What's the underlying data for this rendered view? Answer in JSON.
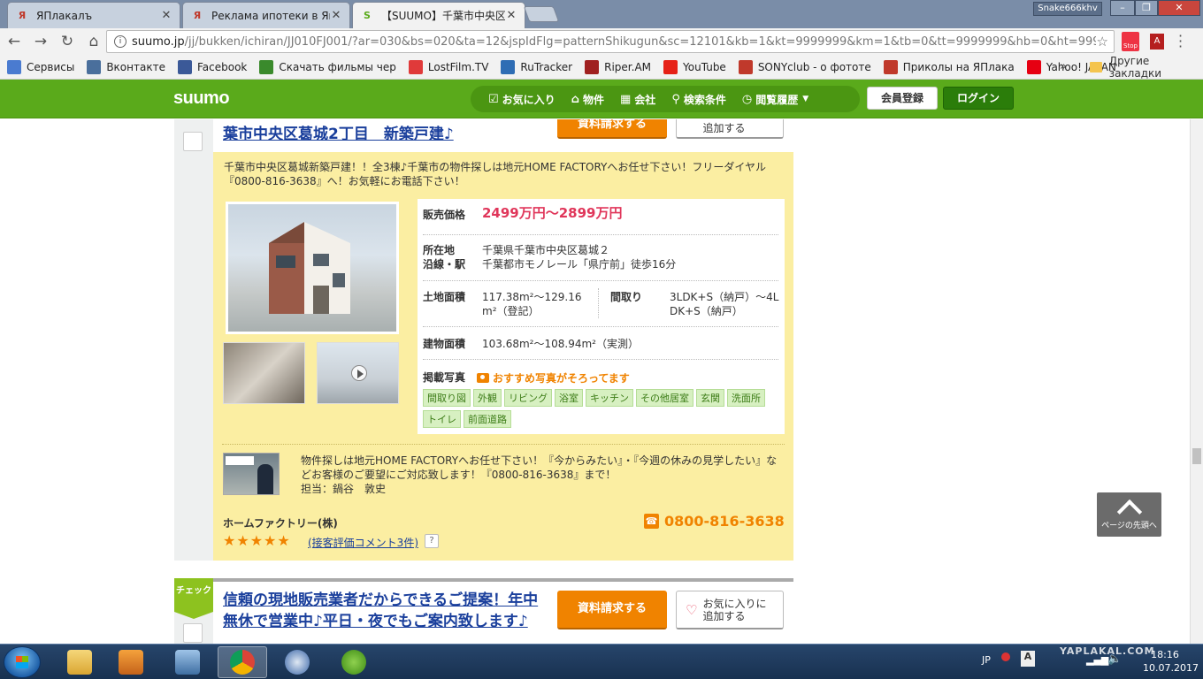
{
  "browser": {
    "tabs": [
      {
        "title": "ЯПлакалъ",
        "favicon": "yaplakal-icon",
        "active": false
      },
      {
        "title": "Реклама ипотеки в Япон",
        "favicon": "yaplakal-icon",
        "active": false
      },
      {
        "title": "【SUUMO】千葉市中央区",
        "favicon": "suumo-icon",
        "active": true
      }
    ],
    "user_name": "Snake666khv",
    "url_host": "suumo.jp",
    "url_path": "/jj/bukken/ichiran/JJ010FJ001/?ar=030&bs=020&ta=12&jspIdFlg=patternShikugun&sc=12101&kb=1&kt=9999999&km=1&tb=0&tt=9999999&hb=0&ht=9999999&",
    "ext_stop_label": "Stop",
    "bookmarks": [
      {
        "label": "Сервисы",
        "color": "#4a7bd0"
      },
      {
        "label": "Вконтакте",
        "color": "#4a6f9c"
      },
      {
        "label": "Facebook",
        "color": "#3b5998"
      },
      {
        "label": "Скачать фильмы чер",
        "color": "#3a8a2c"
      },
      {
        "label": "LostFilm.TV",
        "color": "#e03a3a"
      },
      {
        "label": "RuTracker",
        "color": "#2e6db4"
      },
      {
        "label": "Riper.AM",
        "color": "#a02020"
      },
      {
        "label": "YouTube",
        "color": "#e62117"
      },
      {
        "label": "SONYclub - о фототе",
        "color": "#c0392b"
      },
      {
        "label": "Приколы на ЯПлака",
        "color": "#c0392b"
      },
      {
        "label": "Yahoo! JAPAN",
        "color": "#e60012"
      }
    ],
    "bookmarks_more": "»",
    "bookmarks_other": "Другие закладки"
  },
  "suumo": {
    "logo": "suumo",
    "nav": [
      {
        "label": "お気に入り",
        "icon": "checkbox-icon"
      },
      {
        "label": "物件",
        "icon": "house-icon"
      },
      {
        "label": "会社",
        "icon": "building-icon"
      },
      {
        "label": "検索条件",
        "icon": "search-icon"
      },
      {
        "label": "閲覧履歴",
        "icon": "clock-icon"
      }
    ],
    "register_label": "会員登録",
    "login_label": "ログイン"
  },
  "listing": {
    "title": "葉市中央区葛城2丁目　新築戸建♪",
    "request_label": "資料請求する",
    "fav_label_line1": "お気に入りに",
    "fav_label_line2": "追加する",
    "intro": "千葉市中央区葛城新築戸建！！全3棟♪千葉市の物件探しは地元HOME FACTORYへお任せ下さい！フリーダイヤル『0800-816-3638』へ！お気軽にお電話下さい！",
    "specs": {
      "price_label": "販売価格",
      "price_value": "2499万円～2899万円",
      "location_label": "所在地",
      "location_value": "千葉県千葉市中央区葛城２",
      "station_label": "沿線・駅",
      "station_value": "千葉都市モノレール「県庁前」徒歩16分",
      "land_label": "土地面積",
      "land_value_line1": "117.38m²～129.16",
      "land_value_line2": "m²（登記）",
      "layout_label": "間取り",
      "layout_value_line1": "3LDK+S（納戸）～4L",
      "layout_value_line2": "DK+S（納戸）",
      "building_label": "建物面積",
      "building_value": "103.68m²～108.94m²（実測）",
      "photos_label": "掲載写真",
      "photos_note": "おすすめ写真がそろってます",
      "photo_tags": [
        "間取り図",
        "外観",
        "リビング",
        "浴室",
        "キッチン",
        "その他居室",
        "玄関",
        "洗面所",
        "トイレ",
        "前面道路"
      ]
    },
    "agent_text": "物件探しは地元HOME FACTORYへお任せ下さい！『今からみたい』・『今週の休みの見学したい』などお客様のご要望にご対応致します！『0800-816-3638』まで！",
    "agent_person": "担当：鍋谷　敦史",
    "company": "ホームファクトリー(株)",
    "stars": "★★★★★",
    "rating": 5,
    "review_link": "(接客評価コメント3件)",
    "help": "?",
    "phone": "0800-816-3638"
  },
  "next_listing": {
    "badge": "チェック",
    "title": "信頼の現地販売業者だからできるご提案！年中無休で営業中♪平日・夜でもご案内致します♪",
    "request_label": "資料請求する",
    "fav_label_line1": "お気に入りに",
    "fav_label_line2": "追加する"
  },
  "to_top_label": "ページの先頭へ",
  "taskbar": {
    "lang": "JP",
    "time": "18:16",
    "date": "10.07.2017",
    "watermark": "YAPLAKAL.COM"
  },
  "colors": {
    "suumo_green": "#5aaa1b",
    "accent_orange": "#f08300",
    "price_red": "#e0365a",
    "panel_yellow": "#fbeea2",
    "link_blue": "#1a3f9c"
  }
}
